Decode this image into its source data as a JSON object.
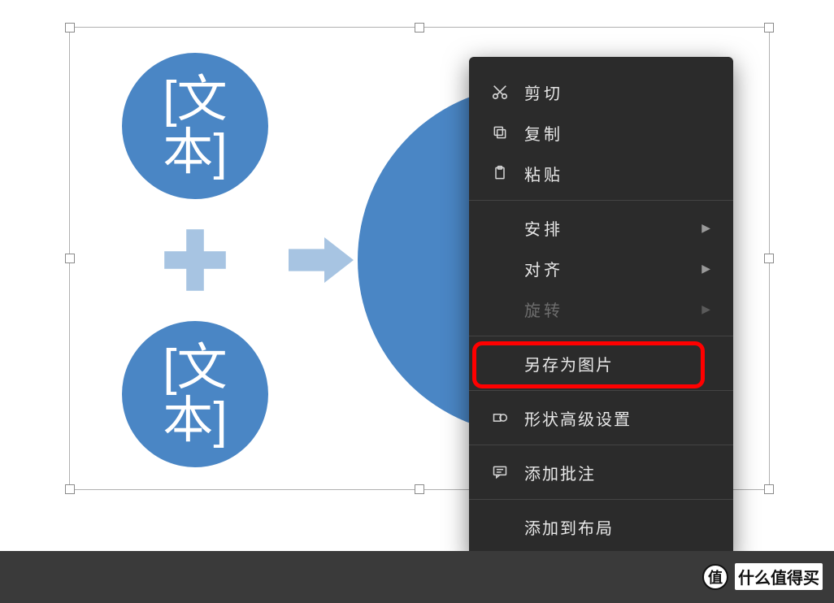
{
  "shapes": {
    "circle_top_text": "[文\n本]",
    "circle_bottom_text": "[文\n本]",
    "circle_big_text": "["
  },
  "context_menu": {
    "cut": "剪切",
    "copy": "复制",
    "paste": "粘贴",
    "arrange": "安排",
    "align": "对齐",
    "rotate": "旋转",
    "save_as_picture": "另存为图片",
    "shape_advanced": "形状高级设置",
    "add_comment": "添加批注",
    "add_to_layout": "添加到布局"
  },
  "watermark": {
    "badge": "值",
    "text": "什么值得买"
  }
}
